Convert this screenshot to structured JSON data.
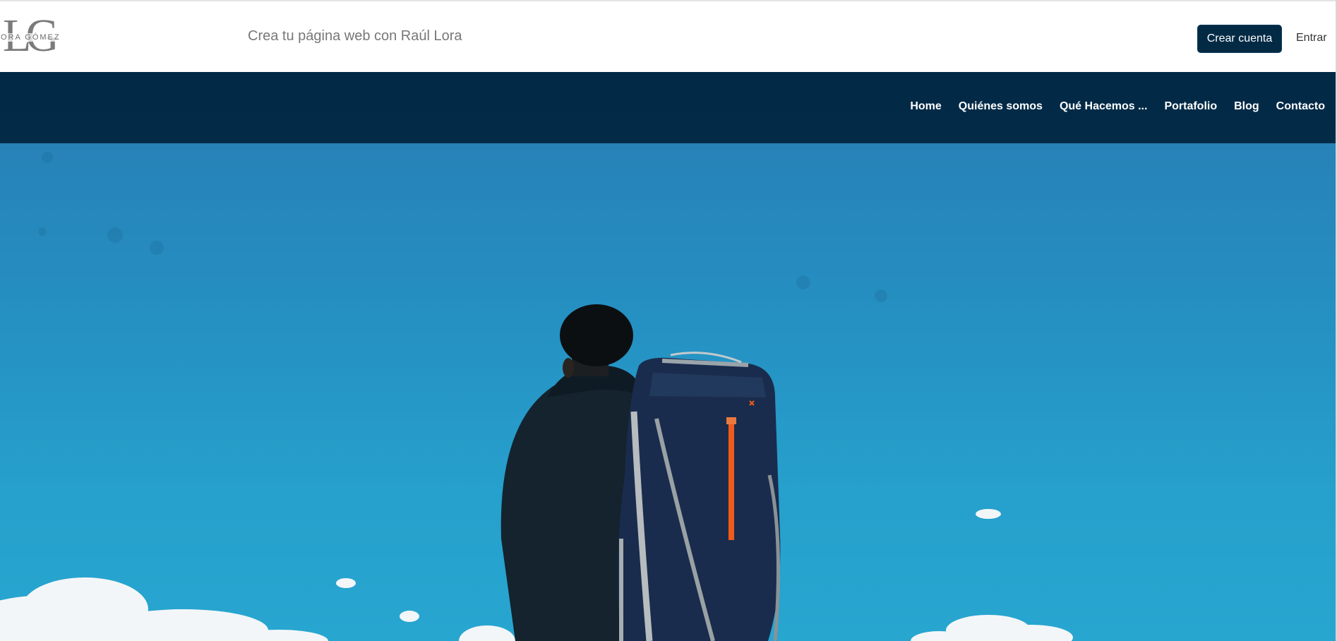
{
  "header": {
    "logo": {
      "letters": "LG",
      "subtitle": "ORA GÓMEZ",
      "color": "#7b7b7b"
    },
    "tagline": "Crea tu página web con Raúl Lora",
    "create_account_label": "Crear cuenta",
    "login_label": "Entrar"
  },
  "nav": {
    "background": "#022a47",
    "items": [
      {
        "label": "Home"
      },
      {
        "label": "Quiénes somos"
      },
      {
        "label": "Qué Hacemos ..."
      },
      {
        "label": "Portafolio"
      },
      {
        "label": "Blog"
      },
      {
        "label": "Contacto"
      }
    ]
  },
  "hero": {
    "image_subject": "hiker-with-backpack-photo",
    "sky_colors": [
      "#2782b8",
      "#27a6d0"
    ],
    "accent_zipper_color": "#f05a1a"
  }
}
